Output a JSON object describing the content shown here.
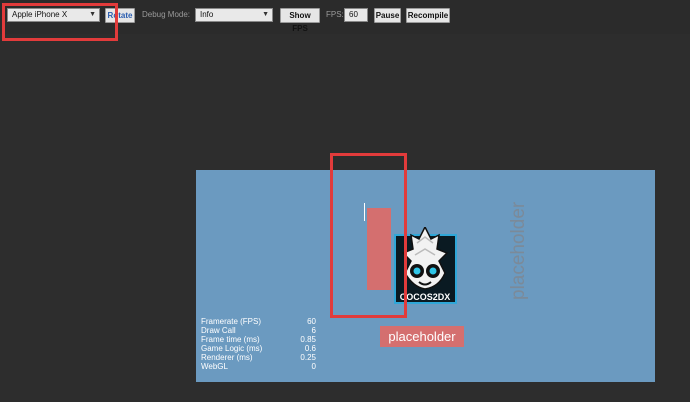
{
  "toolbar": {
    "device_select": "Apple iPhone X",
    "rotate_label": "Rotate",
    "debug_mode_label": "Debug Mode:",
    "debug_mode_value": "Info",
    "show_fps_label": "Show FPS",
    "fps_label": "FPS:",
    "fps_value": "60",
    "pause_label": "Pause",
    "recompile_label": "Recompile"
  },
  "canvas": {
    "placeholder_rotated": "placeholder",
    "placeholder_bottom": "placeholder",
    "logo_text": "COCOS2DX",
    "stats": [
      {
        "label": "Framerate (FPS)",
        "value": "60"
      },
      {
        "label": "Draw Call",
        "value": "6"
      },
      {
        "label": "Frame time (ms)",
        "value": "0.85"
      },
      {
        "label": "Game Logic (ms)",
        "value": "0.6"
      },
      {
        "label": "Renderer (ms)",
        "value": "0.25"
      },
      {
        "label": "WebGL",
        "value": "0"
      }
    ]
  },
  "colors": {
    "background": "#2d2d2d",
    "canvas": "#6b9ac0",
    "placeholder": "#d46f6f",
    "highlight": "#e23b3b"
  }
}
